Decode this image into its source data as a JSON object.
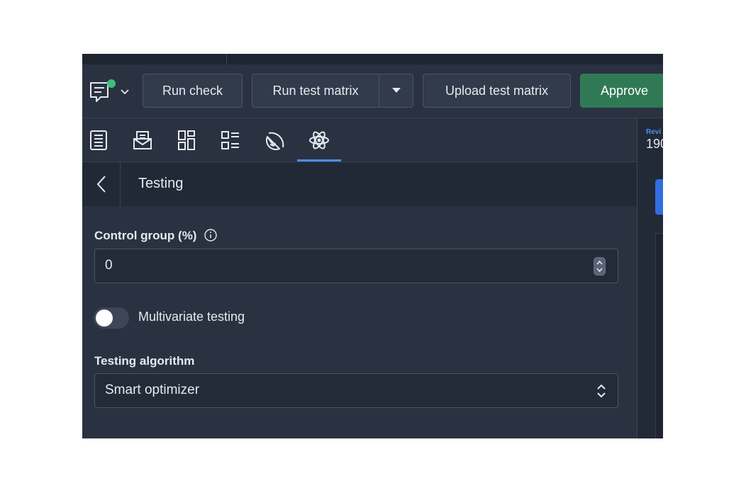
{
  "toolbar": {
    "chat_icon": "chat-icon",
    "status_color": "#3fbf7f",
    "run_check": "Run check",
    "run_test_matrix": "Run test matrix",
    "upload_test_matrix": "Upload test matrix",
    "approve": "Approve"
  },
  "tabs": [
    {
      "icon": "document-icon",
      "active": false
    },
    {
      "icon": "mail-icon",
      "active": false
    },
    {
      "icon": "layout-icon",
      "active": false
    },
    {
      "icon": "list-icon",
      "active": false
    },
    {
      "icon": "citrus-icon",
      "active": false
    },
    {
      "icon": "atom-icon",
      "active": true
    }
  ],
  "right_panel": {
    "label": "Revi",
    "value": "190"
  },
  "panel": {
    "title": "Testing",
    "control_group": {
      "label": "Control group (%)",
      "value": "0"
    },
    "multivariate": {
      "label": "Multivariate testing",
      "enabled": false
    },
    "algorithm": {
      "label": "Testing algorithm",
      "value": "Smart optimizer"
    }
  },
  "colors": {
    "accent": "#4f8cf0",
    "approve": "#2f7a55",
    "background": "#2a3241"
  }
}
